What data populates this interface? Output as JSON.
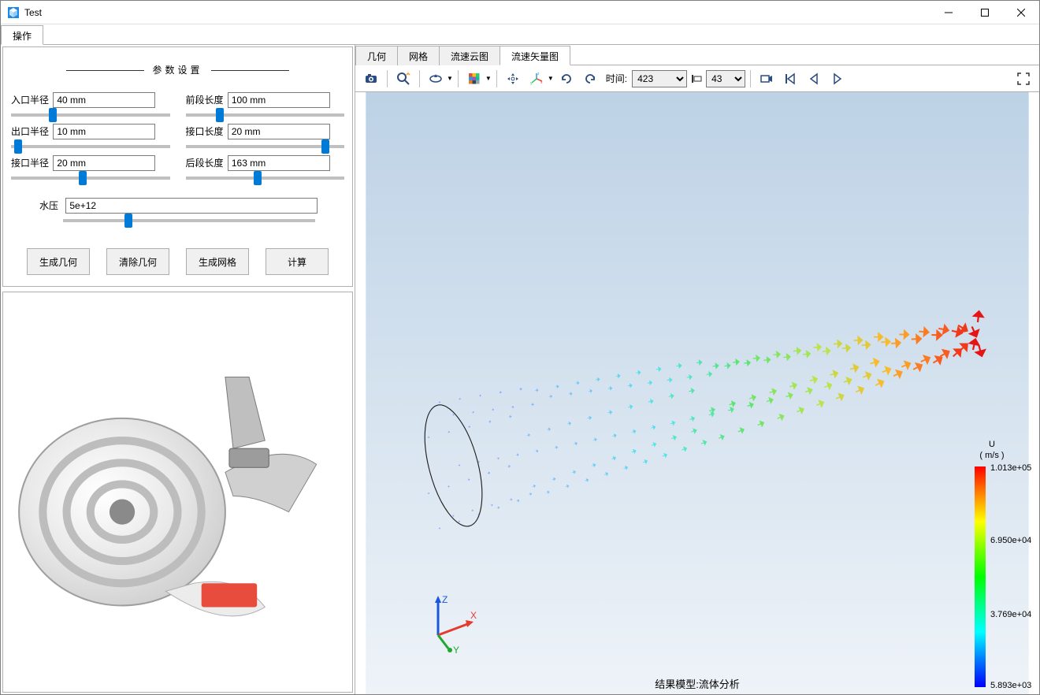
{
  "window": {
    "title": "Test"
  },
  "main_tabs": {
    "items": [
      "操作"
    ],
    "active": 0
  },
  "params": {
    "section_title": "参数设置",
    "inlet_radius": {
      "label": "入口半径",
      "value": "40 mm",
      "pos": 25
    },
    "outlet_radius": {
      "label": "出口半径",
      "value": "10 mm",
      "pos": 2
    },
    "joint_radius": {
      "label": "接口半径",
      "value": "20 mm",
      "pos": 45
    },
    "front_length": {
      "label": "前段长度",
      "value": "100 mm",
      "pos": 20
    },
    "joint_length": {
      "label": "接口长度",
      "value": "20 mm",
      "pos": 90
    },
    "rear_length": {
      "label": "后段长度",
      "value": "163 mm",
      "pos": 45
    },
    "pressure": {
      "label": "水压",
      "value": "5e+12",
      "pos": 25
    }
  },
  "buttons": {
    "gen_geom": "生成几何",
    "clear_geom": "清除几何",
    "gen_mesh": "生成网格",
    "compute": "计算"
  },
  "right_tabs": {
    "items": [
      "几何",
      "网格",
      "流速云图",
      "流速矢量图"
    ],
    "active": 3
  },
  "toolbar": {
    "time_label": "时间:",
    "time_select": "423",
    "frame_select": "43"
  },
  "legend": {
    "title_line1": "U",
    "title_line2": "( m/s )",
    "ticks": [
      {
        "label": "1.013e+05",
        "pct": 0
      },
      {
        "label": "6.950e+04",
        "pct": 33
      },
      {
        "label": "3.769e+04",
        "pct": 67
      },
      {
        "label": "5.893e+03",
        "pct": 100
      }
    ]
  },
  "footer": "结果模型:流体分析",
  "axes": {
    "x": "X",
    "y": "Y",
    "z": "Z"
  }
}
